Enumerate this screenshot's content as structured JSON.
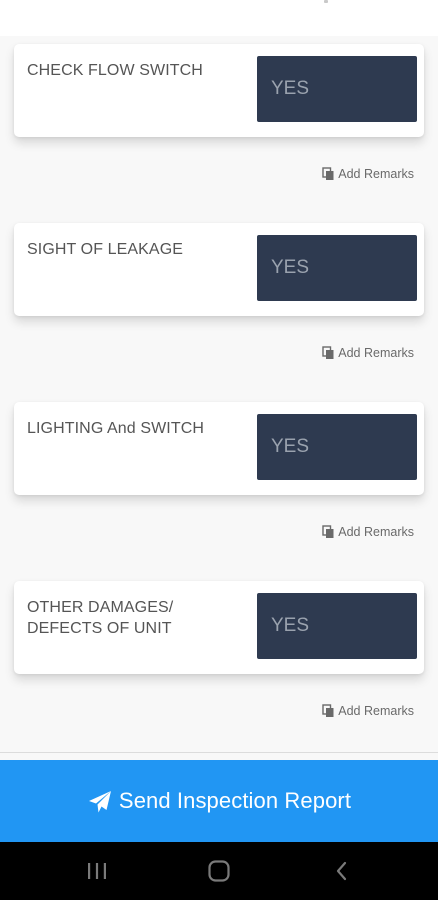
{
  "colors": {
    "answer_button_bg": "#2e3a50",
    "answer_button_text": "#9aa2ae",
    "send_bar_bg": "#2196f3",
    "nav_bar_bg": "#000000"
  },
  "items": [
    {
      "label": "CHECK FLOW SWITCH",
      "answer": "YES",
      "remarks_label": "Add Remarks"
    },
    {
      "label": "SIGHT OF LEAKAGE",
      "answer": "YES",
      "remarks_label": "Add Remarks"
    },
    {
      "label": "LIGHTING And SWITCH",
      "answer": "YES",
      "remarks_label": "Add Remarks"
    },
    {
      "label": "OTHER DAMAGES/\nDEFECTS OF UNIT",
      "answer": "YES",
      "remarks_label": "Add Remarks"
    }
  ],
  "remarks_icon": "copy-icon",
  "send": {
    "label": "Send Inspection Report",
    "icon": "paper-plane-icon"
  },
  "nav": {
    "recents_icon": "recents-icon",
    "home_icon": "home-icon",
    "back_icon": "back-icon"
  }
}
